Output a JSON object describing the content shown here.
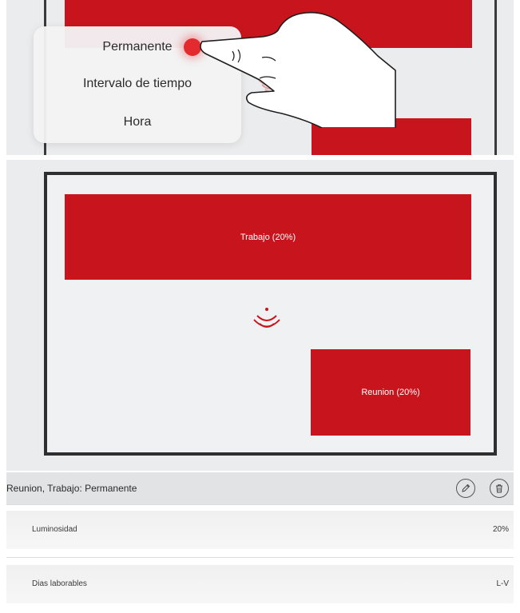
{
  "top_menu": {
    "items": [
      "Permanente",
      "Intervalo de tiempo",
      "Hora"
    ]
  },
  "zones": {
    "trabajo": "Trabajo (20%)",
    "reunion": "Reunion (20%)"
  },
  "detail": {
    "title": "Reunion, Trabajo: Permanente",
    "rows": [
      {
        "label": "Luminosidad",
        "value": "20%"
      },
      {
        "label": "Dias laborables",
        "value": "L-V"
      }
    ]
  },
  "icons": {
    "sensor": "motion-sensor-icon",
    "edit": "pencil-icon",
    "delete": "trash-icon",
    "gesture": "hand-tap-icon"
  },
  "colors": {
    "accent_red": "#c8151d",
    "frame": "#2f2f2f",
    "background": "#ebeced"
  }
}
